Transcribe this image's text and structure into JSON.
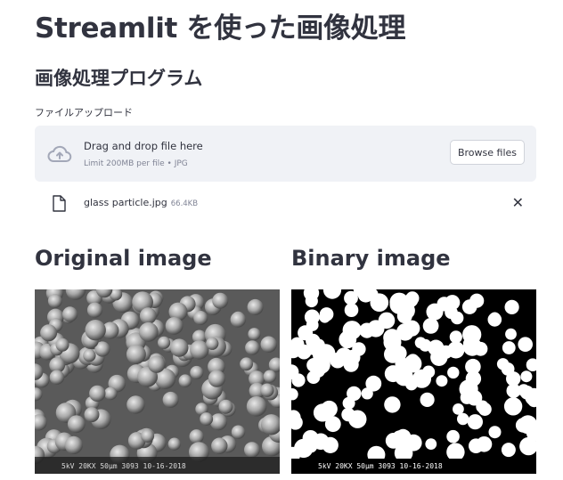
{
  "page": {
    "title": "Streamlit を使った画像処理",
    "subtitle": "画像処理プログラム"
  },
  "uploader": {
    "label": "ファイルアップロード",
    "drop_text": "Drag and drop file here",
    "limit_text": "Limit 200MB per file • JPG",
    "browse_label": "Browse files",
    "icon": "cloud-upload-icon"
  },
  "uploaded_file": {
    "name": "glass particle.jpg",
    "size": "66.4KB",
    "icon": "file-icon",
    "remove_icon": "close-icon"
  },
  "columns": {
    "original_title": "Original image",
    "binary_title": "Binary image"
  },
  "colors": {
    "text": "#31333f",
    "dropzone_bg": "#f0f2f6",
    "muted": "#808495"
  }
}
